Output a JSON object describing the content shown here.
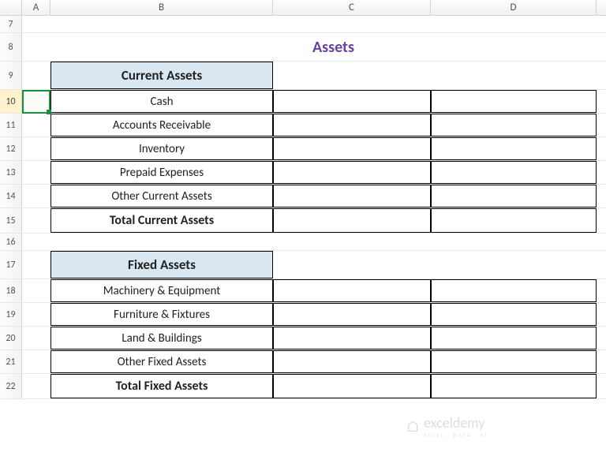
{
  "columns": [
    "A",
    "B",
    "C",
    "D"
  ],
  "rows": [
    "7",
    "8",
    "9",
    "10",
    "11",
    "12",
    "13",
    "14",
    "15",
    "16",
    "17",
    "18",
    "19",
    "20",
    "21",
    "22"
  ],
  "active_row": "10",
  "title": "Assets",
  "sections": [
    {
      "header": "Current Assets",
      "items": [
        "Cash",
        "Accounts Receivable",
        "Inventory",
        "Prepaid Expenses",
        "Other Current Assets"
      ],
      "total": "Total Current Assets"
    },
    {
      "header": "Fixed Assets",
      "items": [
        "Machinery & Equipment",
        "Furniture & Fixtures",
        "Land & Buildings",
        "Other Fixed Assets"
      ],
      "total": "Total Fixed Assets"
    }
  ],
  "watermark": {
    "brand": "exceldemy",
    "tag": "EXCEL · DATA · BI"
  }
}
